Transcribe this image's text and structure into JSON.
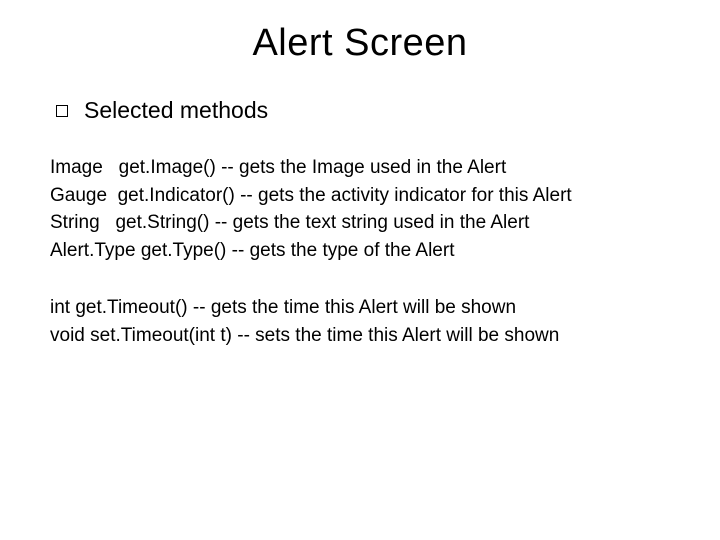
{
  "title": "Alert Screen",
  "bullet": "Selected methods",
  "block1": {
    "l1": "Image   get.Image() -- gets the Image used in the Alert",
    "l2": "Gauge  get.Indicator() -- gets the activity indicator for this Alert",
    "l3": "String   get.String() -- gets the text string used in the Alert",
    "l4": "Alert.Type get.Type() -- gets the type of the Alert"
  },
  "block2": {
    "l1": "int get.Timeout() -- gets the time this Alert will be shown",
    "l2": "void set.Timeout(int t) -- sets the time this Alert will be shown"
  }
}
